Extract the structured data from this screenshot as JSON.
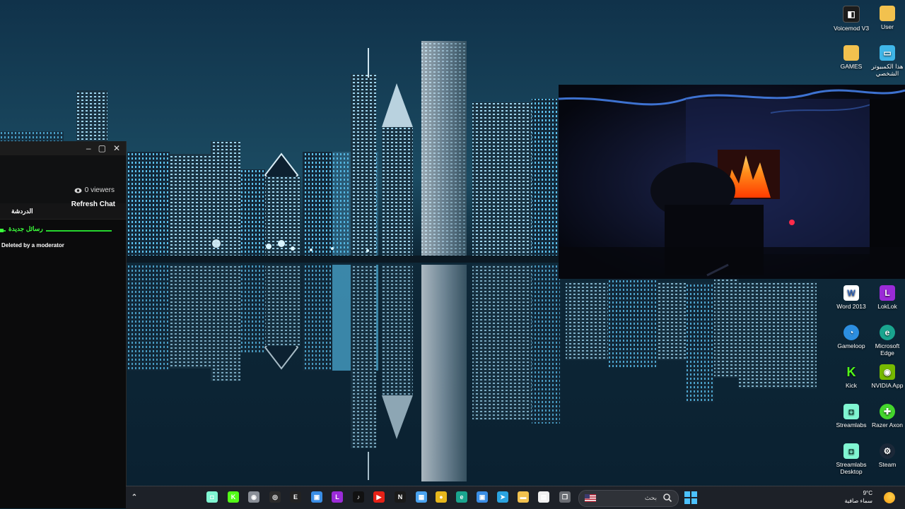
{
  "chat": {
    "viewers": "0 viewers",
    "refresh_label": "Refresh Chat",
    "tab_label": "الدردشة",
    "new_messages_label": "رسائل جديدة",
    "deleted_message": "Deleted by a moderator",
    "window_controls": [
      "–",
      "▢",
      "✕"
    ]
  },
  "desktop_icons": [
    {
      "label": "Voicemod V3",
      "icon": "voicemod-icon",
      "color": "#1c1c1c"
    },
    {
      "label": "User",
      "icon": "folder-icon",
      "color": "#f2c14e"
    },
    {
      "label": "GAMES",
      "icon": "folder-icon",
      "color": "#f2c14e"
    },
    {
      "label": "هذا الكمبيوتر الشخصي",
      "icon": "computer-icon",
      "color": "#3fb6e8"
    },
    {
      "label": "Word 2013",
      "icon": "word-icon",
      "color": "#ffffff"
    },
    {
      "label": "LokLok",
      "icon": "loklok-icon",
      "color": "#9b2bd8"
    },
    {
      "label": "Gameloop",
      "icon": "gameloop-icon",
      "color": "#2c8ee0"
    },
    {
      "label": "Microsoft Edge",
      "icon": "edge-icon",
      "color": "#1aa58f"
    },
    {
      "label": "Kick",
      "icon": "kick-icon",
      "color": "#53fc18"
    },
    {
      "label": "NVIDIA App",
      "icon": "nvidia-icon",
      "color": "#76b900"
    },
    {
      "label": "Streamlabs",
      "icon": "streamlabs-icon",
      "color": "#80f5d2"
    },
    {
      "label": "Razer Axon",
      "icon": "razer-icon",
      "color": "#44d62c"
    },
    {
      "label": "Streamlabs Desktop",
      "icon": "streamlabs-icon",
      "color": "#80f5d2"
    },
    {
      "label": "Steam",
      "icon": "steam-icon",
      "color": "#1b2838"
    }
  ],
  "taskbar": {
    "search_placeholder": "بحث",
    "temperature": "9°C",
    "weather": "سماء صافية",
    "apps": [
      {
        "name": "streamlabs",
        "color": "#80f5d2",
        "glyph": "◘"
      },
      {
        "name": "kick",
        "color": "#53fc18",
        "glyph": "K"
      },
      {
        "name": "camera",
        "color": "#8a8f98",
        "glyph": "◉"
      },
      {
        "name": "obs",
        "color": "#2b2b2b",
        "glyph": "◎"
      },
      {
        "name": "epic-games",
        "color": "#222222",
        "glyph": "E"
      },
      {
        "name": "app-window",
        "color": "#3a8ee6",
        "glyph": "▣"
      },
      {
        "name": "loklok",
        "color": "#9b2bd8",
        "glyph": "L"
      },
      {
        "name": "tiktok",
        "color": "#111111",
        "glyph": "♪"
      },
      {
        "name": "youtube",
        "color": "#e62117",
        "glyph": "▶"
      },
      {
        "name": "netflix",
        "color": "#1a1a1a",
        "glyph": "N"
      },
      {
        "name": "files",
        "color": "#4aa3f0",
        "glyph": "▦"
      },
      {
        "name": "chrome",
        "color": "#e8b81c",
        "glyph": "●"
      },
      {
        "name": "edge",
        "color": "#1aa58f",
        "glyph": "e"
      },
      {
        "name": "app-window-2",
        "color": "#3a8ee6",
        "glyph": "▣"
      },
      {
        "name": "telegram",
        "color": "#2aa3e0",
        "glyph": "➤"
      },
      {
        "name": "file-explorer",
        "color": "#f2c14e",
        "glyph": "▬"
      },
      {
        "name": "store",
        "color": "#f0f0f0",
        "glyph": "▤"
      },
      {
        "name": "task-view",
        "color": "#6a6d73",
        "glyph": "❐"
      }
    ]
  }
}
